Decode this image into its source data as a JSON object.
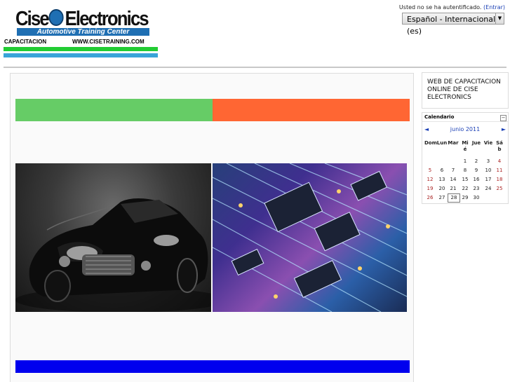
{
  "logo": {
    "title_left": "Cise",
    "title_right": "Electronics",
    "tagline": "Automotive Training Center",
    "sub_left": "CAPACITACION",
    "sub_right": "WWW.CISETRAINING.COM"
  },
  "header": {
    "login_text": "Usted no se ha autentificado.",
    "login_link": "(Entrar)",
    "language": "Español - Internacional (es)"
  },
  "colors": {
    "green_bar": "#66cc66",
    "orange_bar": "#ff6633",
    "blue_bar": "#0000ee",
    "link": "#1a3fb5",
    "weekend": "#aa2222"
  },
  "sidebar": {
    "site_title": "WEB DE CAPACITACION ONLINE DE CISE ELECTRONICS"
  },
  "calendar": {
    "block_title": "Calendario",
    "toggle": "−",
    "prev": "◄",
    "next": "►",
    "month": "junio 2011",
    "days": [
      "Dom",
      "Lun",
      "Mar",
      "Mi\né",
      "Jue",
      "Vie",
      "Sá\nb"
    ],
    "weeks": [
      [
        "",
        "",
        "",
        "1",
        "2",
        "3",
        "4"
      ],
      [
        "5",
        "6",
        "7",
        "8",
        "9",
        "10",
        "11"
      ],
      [
        "12",
        "13",
        "14",
        "15",
        "16",
        "17",
        "18"
      ],
      [
        "19",
        "20",
        "21",
        "22",
        "23",
        "24",
        "25"
      ],
      [
        "26",
        "27",
        "28",
        "29",
        "30",
        "",
        ""
      ]
    ],
    "today": "28"
  },
  "images": {
    "left": "car-image",
    "right": "circuit-board-image"
  }
}
